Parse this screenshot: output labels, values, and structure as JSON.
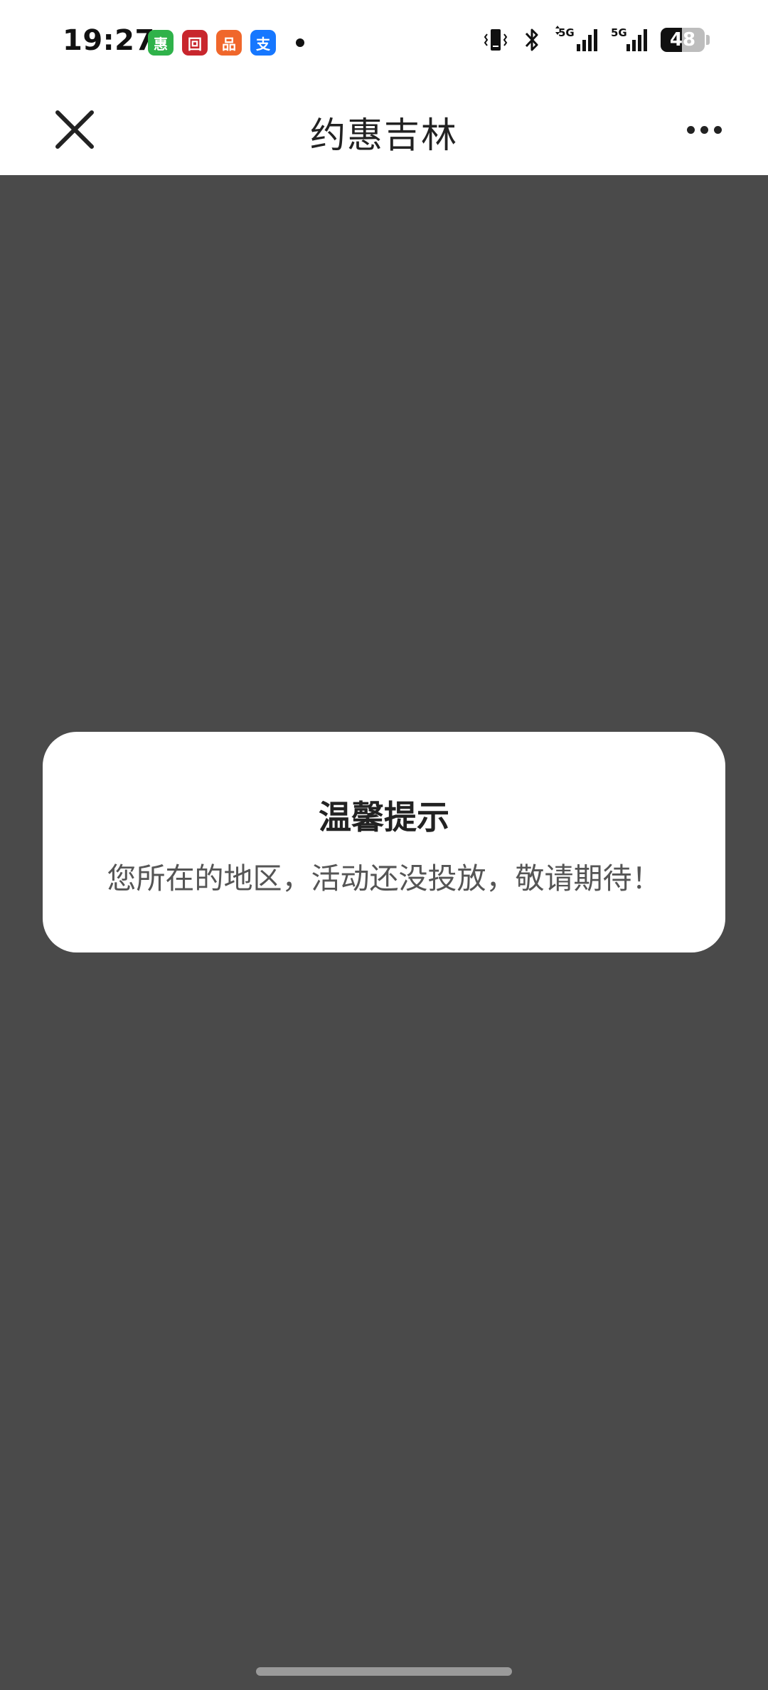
{
  "status_bar": {
    "time": "19:27",
    "apps": [
      {
        "name": "green-app-icon",
        "glyph": "惠",
        "color": "#2fb24a"
      },
      {
        "name": "red-bank-app-icon",
        "glyph": "回",
        "color": "#c8262d"
      },
      {
        "name": "orange-app-icon",
        "glyph": "品",
        "color": "#f0672b"
      },
      {
        "name": "alipay-app-icon",
        "glyph": "支",
        "color": "#1677ff"
      }
    ],
    "network_1": "5G",
    "network_2": "5G",
    "battery": "48",
    "battery_level": 0.48
  },
  "nav": {
    "title": "约惠吉林"
  },
  "dialog": {
    "title": "温馨提示",
    "message": "您所在的地区，活动还没投放，敬请期待！"
  }
}
